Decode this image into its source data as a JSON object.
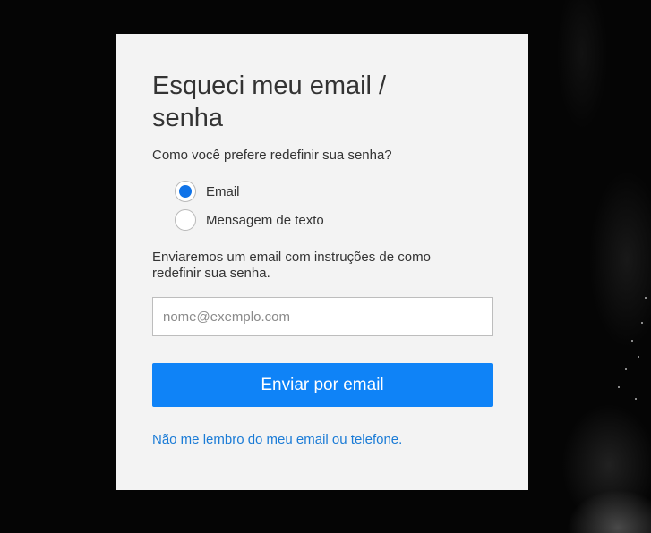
{
  "form": {
    "title": "Esqueci meu email / senha",
    "prompt": "Como você prefere redefinir sua senha?",
    "options": [
      {
        "label": "Email",
        "selected": true
      },
      {
        "label": "Mensagem de texto",
        "selected": false
      }
    ],
    "info": "Enviaremos um email com instruções de como redefinir sua senha.",
    "email_placeholder": "nome@exemplo.com",
    "email_value": "",
    "submit_label": "Enviar por email",
    "forgot_link": "Não me lembro do meu email ou telefone."
  },
  "colors": {
    "accent": "#0f83f7",
    "link": "#1a7bd6",
    "card_bg": "#f3f3f3",
    "page_bg": "#050505"
  }
}
